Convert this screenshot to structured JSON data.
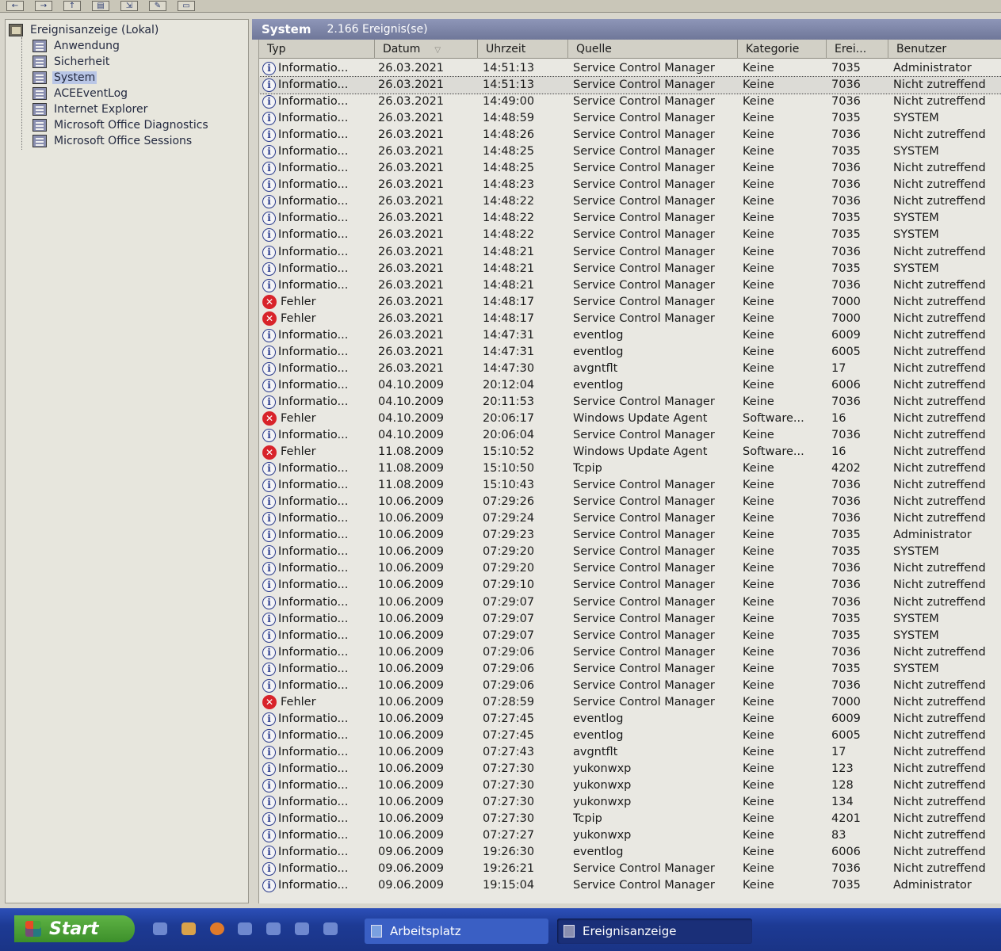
{
  "tree": {
    "root": "Ereignisanzeige (Lokal)",
    "items": [
      {
        "label": "Anwendung"
      },
      {
        "label": "Sicherheit"
      },
      {
        "label": "System"
      },
      {
        "label": "ACEEventLog"
      },
      {
        "label": "Internet Explorer"
      },
      {
        "label": "Microsoft Office Diagnostics"
      },
      {
        "label": "Microsoft Office Sessions"
      }
    ],
    "selected": "System"
  },
  "pane": {
    "title": "System",
    "count": "2.166 Ereignis(se)"
  },
  "columns": {
    "type": "Typ",
    "date": "Datum",
    "time": "Uhrzeit",
    "source": "Quelle",
    "category": "Kategorie",
    "event": "Erei...",
    "user": "Benutzer"
  },
  "rows": [
    {
      "type": "Informatio...",
      "kind": "info",
      "date": "26.03.2021",
      "time": "14:51:13",
      "source": "Service Control Manager",
      "category": "Keine",
      "event": "7035",
      "user": "Administrator"
    },
    {
      "type": "Informatio...",
      "kind": "info",
      "date": "26.03.2021",
      "time": "14:51:13",
      "source": "Service Control Manager",
      "category": "Keine",
      "event": "7036",
      "user": "Nicht zutreffend"
    },
    {
      "type": "Informatio...",
      "kind": "info",
      "date": "26.03.2021",
      "time": "14:49:00",
      "source": "Service Control Manager",
      "category": "Keine",
      "event": "7036",
      "user": "Nicht zutreffend"
    },
    {
      "type": "Informatio...",
      "kind": "info",
      "date": "26.03.2021",
      "time": "14:48:59",
      "source": "Service Control Manager",
      "category": "Keine",
      "event": "7035",
      "user": "SYSTEM"
    },
    {
      "type": "Informatio...",
      "kind": "info",
      "date": "26.03.2021",
      "time": "14:48:26",
      "source": "Service Control Manager",
      "category": "Keine",
      "event": "7036",
      "user": "Nicht zutreffend"
    },
    {
      "type": "Informatio...",
      "kind": "info",
      "date": "26.03.2021",
      "time": "14:48:25",
      "source": "Service Control Manager",
      "category": "Keine",
      "event": "7035",
      "user": "SYSTEM"
    },
    {
      "type": "Informatio...",
      "kind": "info",
      "date": "26.03.2021",
      "time": "14:48:25",
      "source": "Service Control Manager",
      "category": "Keine",
      "event": "7036",
      "user": "Nicht zutreffend"
    },
    {
      "type": "Informatio...",
      "kind": "info",
      "date": "26.03.2021",
      "time": "14:48:23",
      "source": "Service Control Manager",
      "category": "Keine",
      "event": "7036",
      "user": "Nicht zutreffend"
    },
    {
      "type": "Informatio...",
      "kind": "info",
      "date": "26.03.2021",
      "time": "14:48:22",
      "source": "Service Control Manager",
      "category": "Keine",
      "event": "7036",
      "user": "Nicht zutreffend"
    },
    {
      "type": "Informatio...",
      "kind": "info",
      "date": "26.03.2021",
      "time": "14:48:22",
      "source": "Service Control Manager",
      "category": "Keine",
      "event": "7035",
      "user": "SYSTEM"
    },
    {
      "type": "Informatio...",
      "kind": "info",
      "date": "26.03.2021",
      "time": "14:48:22",
      "source": "Service Control Manager",
      "category": "Keine",
      "event": "7035",
      "user": "SYSTEM"
    },
    {
      "type": "Informatio...",
      "kind": "info",
      "date": "26.03.2021",
      "time": "14:48:21",
      "source": "Service Control Manager",
      "category": "Keine",
      "event": "7036",
      "user": "Nicht zutreffend"
    },
    {
      "type": "Informatio...",
      "kind": "info",
      "date": "26.03.2021",
      "time": "14:48:21",
      "source": "Service Control Manager",
      "category": "Keine",
      "event": "7035",
      "user": "SYSTEM"
    },
    {
      "type": "Informatio...",
      "kind": "info",
      "date": "26.03.2021",
      "time": "14:48:21",
      "source": "Service Control Manager",
      "category": "Keine",
      "event": "7036",
      "user": "Nicht zutreffend"
    },
    {
      "type": "Fehler",
      "kind": "error",
      "date": "26.03.2021",
      "time": "14:48:17",
      "source": "Service Control Manager",
      "category": "Keine",
      "event": "7000",
      "user": "Nicht zutreffend"
    },
    {
      "type": "Fehler",
      "kind": "error",
      "date": "26.03.2021",
      "time": "14:48:17",
      "source": "Service Control Manager",
      "category": "Keine",
      "event": "7000",
      "user": "Nicht zutreffend"
    },
    {
      "type": "Informatio...",
      "kind": "info",
      "date": "26.03.2021",
      "time": "14:47:31",
      "source": "eventlog",
      "category": "Keine",
      "event": "6009",
      "user": "Nicht zutreffend"
    },
    {
      "type": "Informatio...",
      "kind": "info",
      "date": "26.03.2021",
      "time": "14:47:31",
      "source": "eventlog",
      "category": "Keine",
      "event": "6005",
      "user": "Nicht zutreffend"
    },
    {
      "type": "Informatio...",
      "kind": "info",
      "date": "26.03.2021",
      "time": "14:47:30",
      "source": "avgntflt",
      "category": "Keine",
      "event": "17",
      "user": "Nicht zutreffend"
    },
    {
      "type": "Informatio...",
      "kind": "info",
      "date": "04.10.2009",
      "time": "20:12:04",
      "source": "eventlog",
      "category": "Keine",
      "event": "6006",
      "user": "Nicht zutreffend"
    },
    {
      "type": "Informatio...",
      "kind": "info",
      "date": "04.10.2009",
      "time": "20:11:53",
      "source": "Service Control Manager",
      "category": "Keine",
      "event": "7036",
      "user": "Nicht zutreffend"
    },
    {
      "type": "Fehler",
      "kind": "error",
      "date": "04.10.2009",
      "time": "20:06:17",
      "source": "Windows Update Agent",
      "category": "Software...",
      "event": "16",
      "user": "Nicht zutreffend"
    },
    {
      "type": "Informatio...",
      "kind": "info",
      "date": "04.10.2009",
      "time": "20:06:04",
      "source": "Service Control Manager",
      "category": "Keine",
      "event": "7036",
      "user": "Nicht zutreffend"
    },
    {
      "type": "Fehler",
      "kind": "error",
      "date": "11.08.2009",
      "time": "15:10:52",
      "source": "Windows Update Agent",
      "category": "Software...",
      "event": "16",
      "user": "Nicht zutreffend"
    },
    {
      "type": "Informatio...",
      "kind": "info",
      "date": "11.08.2009",
      "time": "15:10:50",
      "source": "Tcpip",
      "category": "Keine",
      "event": "4202",
      "user": "Nicht zutreffend"
    },
    {
      "type": "Informatio...",
      "kind": "info",
      "date": "11.08.2009",
      "time": "15:10:43",
      "source": "Service Control Manager",
      "category": "Keine",
      "event": "7036",
      "user": "Nicht zutreffend"
    },
    {
      "type": "Informatio...",
      "kind": "info",
      "date": "10.06.2009",
      "time": "07:29:26",
      "source": "Service Control Manager",
      "category": "Keine",
      "event": "7036",
      "user": "Nicht zutreffend"
    },
    {
      "type": "Informatio...",
      "kind": "info",
      "date": "10.06.2009",
      "time": "07:29:24",
      "source": "Service Control Manager",
      "category": "Keine",
      "event": "7036",
      "user": "Nicht zutreffend"
    },
    {
      "type": "Informatio...",
      "kind": "info",
      "date": "10.06.2009",
      "time": "07:29:23",
      "source": "Service Control Manager",
      "category": "Keine",
      "event": "7035",
      "user": "Administrator"
    },
    {
      "type": "Informatio...",
      "kind": "info",
      "date": "10.06.2009",
      "time": "07:29:20",
      "source": "Service Control Manager",
      "category": "Keine",
      "event": "7035",
      "user": "SYSTEM"
    },
    {
      "type": "Informatio...",
      "kind": "info",
      "date": "10.06.2009",
      "time": "07:29:20",
      "source": "Service Control Manager",
      "category": "Keine",
      "event": "7036",
      "user": "Nicht zutreffend"
    },
    {
      "type": "Informatio...",
      "kind": "info",
      "date": "10.06.2009",
      "time": "07:29:10",
      "source": "Service Control Manager",
      "category": "Keine",
      "event": "7036",
      "user": "Nicht zutreffend"
    },
    {
      "type": "Informatio...",
      "kind": "info",
      "date": "10.06.2009",
      "time": "07:29:07",
      "source": "Service Control Manager",
      "category": "Keine",
      "event": "7036",
      "user": "Nicht zutreffend"
    },
    {
      "type": "Informatio...",
      "kind": "info",
      "date": "10.06.2009",
      "time": "07:29:07",
      "source": "Service Control Manager",
      "category": "Keine",
      "event": "7035",
      "user": "SYSTEM"
    },
    {
      "type": "Informatio...",
      "kind": "info",
      "date": "10.06.2009",
      "time": "07:29:07",
      "source": "Service Control Manager",
      "category": "Keine",
      "event": "7035",
      "user": "SYSTEM"
    },
    {
      "type": "Informatio...",
      "kind": "info",
      "date": "10.06.2009",
      "time": "07:29:06",
      "source": "Service Control Manager",
      "category": "Keine",
      "event": "7036",
      "user": "Nicht zutreffend"
    },
    {
      "type": "Informatio...",
      "kind": "info",
      "date": "10.06.2009",
      "time": "07:29:06",
      "source": "Service Control Manager",
      "category": "Keine",
      "event": "7035",
      "user": "SYSTEM"
    },
    {
      "type": "Informatio...",
      "kind": "info",
      "date": "10.06.2009",
      "time": "07:29:06",
      "source": "Service Control Manager",
      "category": "Keine",
      "event": "7036",
      "user": "Nicht zutreffend"
    },
    {
      "type": "Fehler",
      "kind": "error",
      "date": "10.06.2009",
      "time": "07:28:59",
      "source": "Service Control Manager",
      "category": "Keine",
      "event": "7000",
      "user": "Nicht zutreffend"
    },
    {
      "type": "Informatio...",
      "kind": "info",
      "date": "10.06.2009",
      "time": "07:27:45",
      "source": "eventlog",
      "category": "Keine",
      "event": "6009",
      "user": "Nicht zutreffend"
    },
    {
      "type": "Informatio...",
      "kind": "info",
      "date": "10.06.2009",
      "time": "07:27:45",
      "source": "eventlog",
      "category": "Keine",
      "event": "6005",
      "user": "Nicht zutreffend"
    },
    {
      "type": "Informatio...",
      "kind": "info",
      "date": "10.06.2009",
      "time": "07:27:43",
      "source": "avgntflt",
      "category": "Keine",
      "event": "17",
      "user": "Nicht zutreffend"
    },
    {
      "type": "Informatio...",
      "kind": "info",
      "date": "10.06.2009",
      "time": "07:27:30",
      "source": "yukonwxp",
      "category": "Keine",
      "event": "123",
      "user": "Nicht zutreffend"
    },
    {
      "type": "Informatio...",
      "kind": "info",
      "date": "10.06.2009",
      "time": "07:27:30",
      "source": "yukonwxp",
      "category": "Keine",
      "event": "128",
      "user": "Nicht zutreffend"
    },
    {
      "type": "Informatio...",
      "kind": "info",
      "date": "10.06.2009",
      "time": "07:27:30",
      "source": "yukonwxp",
      "category": "Keine",
      "event": "134",
      "user": "Nicht zutreffend"
    },
    {
      "type": "Informatio...",
      "kind": "info",
      "date": "10.06.2009",
      "time": "07:27:30",
      "source": "Tcpip",
      "category": "Keine",
      "event": "4201",
      "user": "Nicht zutreffend"
    },
    {
      "type": "Informatio...",
      "kind": "info",
      "date": "10.06.2009",
      "time": "07:27:27",
      "source": "yukonwxp",
      "category": "Keine",
      "event": "83",
      "user": "Nicht zutreffend"
    },
    {
      "type": "Informatio...",
      "kind": "info",
      "date": "09.06.2009",
      "time": "19:26:30",
      "source": "eventlog",
      "category": "Keine",
      "event": "6006",
      "user": "Nicht zutreffend"
    },
    {
      "type": "Informatio...",
      "kind": "info",
      "date": "09.06.2009",
      "time": "19:26:21",
      "source": "Service Control Manager",
      "category": "Keine",
      "event": "7036",
      "user": "Nicht zutreffend"
    },
    {
      "type": "Informatio...",
      "kind": "info",
      "date": "09.06.2009",
      "time": "19:15:04",
      "source": "Service Control Manager",
      "category": "Keine",
      "event": "7035",
      "user": "Administrator"
    }
  ],
  "taskbar": {
    "start": "Start",
    "tasks": [
      {
        "label": "Arbeitsplatz",
        "active": false
      },
      {
        "label": "Ereignisanzeige",
        "active": true
      }
    ]
  }
}
